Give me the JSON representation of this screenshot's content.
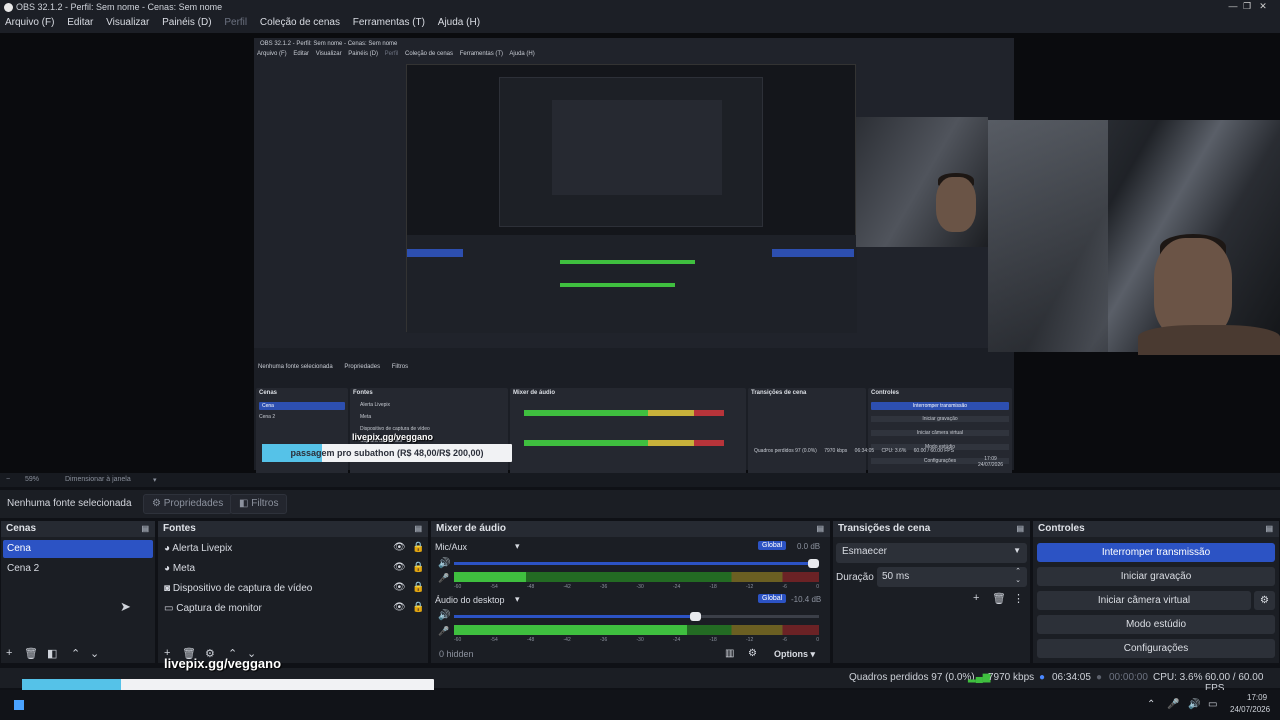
{
  "window": {
    "title": "OBS 32.1.2 - Perfil: Sem nome - Cenas: Sem nome",
    "controls": [
      "—",
      "❐",
      "✕"
    ]
  },
  "menu": [
    {
      "label": "Arquivo (F)"
    },
    {
      "label": "Editar"
    },
    {
      "label": "Visualizar"
    },
    {
      "label": "Painéis (D)"
    },
    {
      "label": "Perfil"
    },
    {
      "label": "Coleção de cenas"
    },
    {
      "label": "Ferramentas (T)"
    },
    {
      "label": "Ajuda (H)"
    }
  ],
  "preview": {
    "nested_title": "OBS 32.1.2 - Perfil: Sem nome - Cenas: Sem nome",
    "nested_menu": [
      "Arquivo (F)",
      "Editar",
      "Visualizar",
      "Painéis (D)",
      "Perfil",
      "Coleção de cenas",
      "Ferramentas (T)",
      "Ajuda (H)"
    ],
    "nested_nosel": "Nenhuma fonte selecionada",
    "nested_props": "Propriedades",
    "nested_filters": "Filtros",
    "nested_panels": {
      "cenas": "Cenas",
      "fontes": "Fontes",
      "mixer": "Mixer de áudio",
      "trans": "Transições de cena",
      "ctrl": "Controles"
    },
    "nested_scenes": [
      "Cena",
      "Cena 2"
    ],
    "nested_sources": [
      "Alerta Livepix",
      "Meta",
      "Dispositivo de captura de vídeo",
      "Captura de monitor"
    ],
    "nested_controls": [
      "Interromper transmissão",
      "Iniciar gravação",
      "Iniciar câmera virtual",
      "Modo estúdio",
      "Configurações"
    ],
    "nested_status": "Quadros perdidos 97 (0.0%)",
    "nested_kbps": "7970 kbps",
    "nested_time": "06:34:05",
    "nested_cpu": "CPU: 3.6%",
    "nested_fps": "60.00 / 60.00 FPS",
    "nested_clock": "17:09",
    "nested_date": "24/07/2026",
    "overlay_url": "livepix.gg/veggano",
    "overlay_text": "passagem pro subathon (R$ 48,00/R$ 200,00)",
    "overlay_progress": 0.24
  },
  "zoom": {
    "value": "59%",
    "mode": "Dimensionar à janela"
  },
  "source_bar": {
    "no_selection": "Nenhuma fonte selecionada",
    "properties": "Propriedades",
    "filters": "Filtros"
  },
  "scenes": {
    "title": "Cenas",
    "items": [
      "Cena",
      "Cena 2"
    ],
    "selected": 0
  },
  "sources": {
    "title": "Fontes",
    "items": [
      {
        "label": "Alerta Livepix",
        "icon": "browser-icon"
      },
      {
        "label": "Meta",
        "icon": "browser-icon"
      },
      {
        "label": "Dispositivo de captura de vídeo",
        "icon": "camera-icon"
      },
      {
        "label": "Captura de monitor",
        "icon": "monitor-icon"
      }
    ]
  },
  "mixer": {
    "title": "Mixer de áudio",
    "channels": [
      {
        "name": "Mic/Aux",
        "badge": "Global",
        "db": "0.0 dB",
        "volume": 1.0
      },
      {
        "name": "Áudio do desktop",
        "badge": "Global",
        "db": "-10.4 dB",
        "volume": 0.66
      }
    ],
    "ticks": [
      "-60",
      "-54",
      "-48",
      "-42",
      "-36",
      "-30",
      "-24",
      "-18",
      "-12",
      "-6",
      "0"
    ],
    "hidden": "0 hidden",
    "options": "Options"
  },
  "transitions": {
    "title": "Transições de cena",
    "selected": "Esmaecer",
    "duration_label": "Duração",
    "duration_value": "50 ms"
  },
  "controls": {
    "title": "Controles",
    "buttons": [
      "Interromper transmissão",
      "Iniciar gravação",
      "Iniciar câmera virtual",
      "Modo estúdio",
      "Configurações"
    ]
  },
  "status": {
    "dropped": "Quadros perdidos 97 (0.0%)",
    "kbps": "7970 kbps",
    "stream_time": "06:34:05",
    "rec_time": "00:00:00",
    "cpu": "CPU: 3.6%",
    "fps": "60.00 / 60.00 FPS"
  },
  "overlay": {
    "url": "livepix.gg/veggano",
    "text": "passagem pro subathon (R$ 48,00/R$ 200,00)",
    "progress": 0.24
  },
  "taskbar": {
    "time": "17:09",
    "date": "24/07/2026"
  },
  "colors": {
    "accent": "#2c53c4",
    "meter_green": "#3fbf3f",
    "meter_yellow": "#c8b13a",
    "meter_red": "#b8343a",
    "overlay_fill": "#55c2e8"
  }
}
